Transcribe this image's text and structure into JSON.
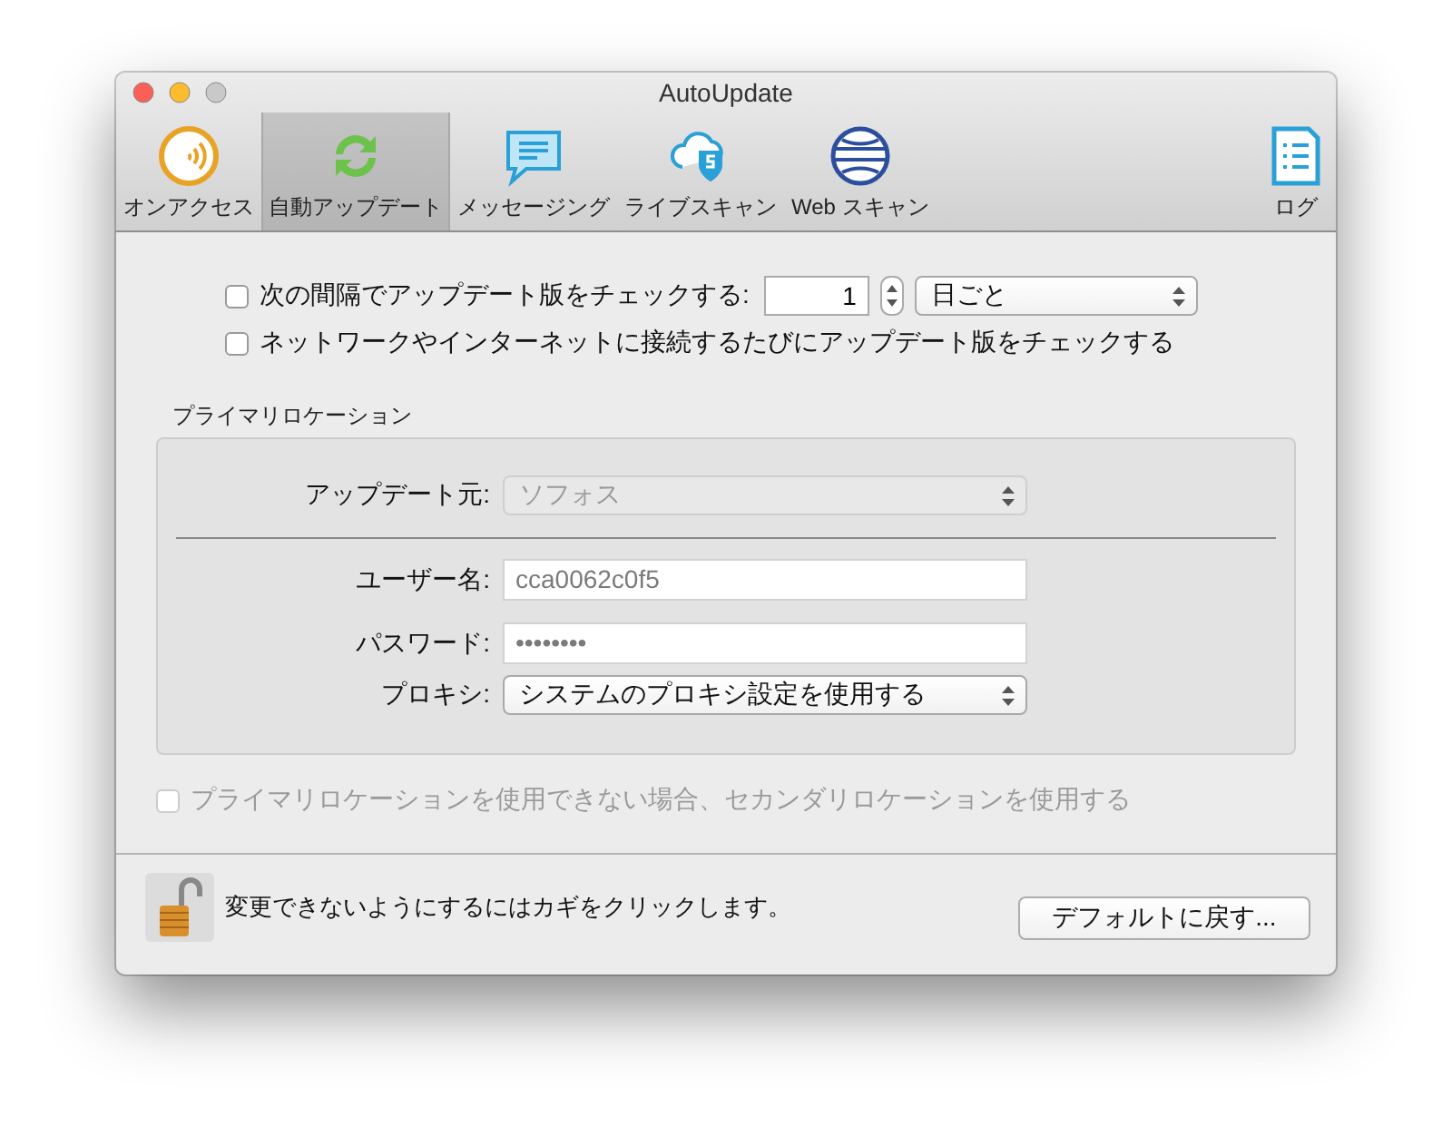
{
  "window": {
    "title": "AutoUpdate"
  },
  "toolbar": [
    {
      "label": "オンアクセス",
      "kind": "onaccess",
      "selected": false
    },
    {
      "label": "自動アップデート",
      "kind": "sync",
      "selected": true
    },
    {
      "label": "メッセージング",
      "kind": "message",
      "selected": false
    },
    {
      "label": "ライブスキャン",
      "kind": "cloud",
      "selected": false
    },
    {
      "label": "Web スキャン",
      "kind": "globe",
      "selected": false
    },
    {
      "label": "ログ",
      "kind": "log",
      "selected": false
    }
  ],
  "schedule": {
    "label": "次の間隔でアップデート版をチェックする:",
    "checked": false,
    "interval": "1",
    "unit": "日ごと"
  },
  "network_check": {
    "label": "ネットワークやインターネットに接続するたびにアップデート版をチェックする",
    "checked": false
  },
  "primary_location": {
    "title": "プライマリロケーション",
    "source_label": "アップデート元:",
    "source": "ソフォス",
    "source_disabled": true,
    "username_label": "ユーザー名:",
    "username": "cca0062c0f5",
    "password_label": "パスワード:",
    "password": "••••••••",
    "proxy_label": "プロキシ:",
    "proxy": "システムのプロキシ設定を使用する"
  },
  "secondary": {
    "label": "プライマリロケーションを使用できない場合、セカンダリロケーションを使用する",
    "checked": false,
    "disabled": true
  },
  "footer": {
    "lock_text": "変更できないようにするにはカギをクリックします。",
    "button": "デフォルトに戻す..."
  }
}
